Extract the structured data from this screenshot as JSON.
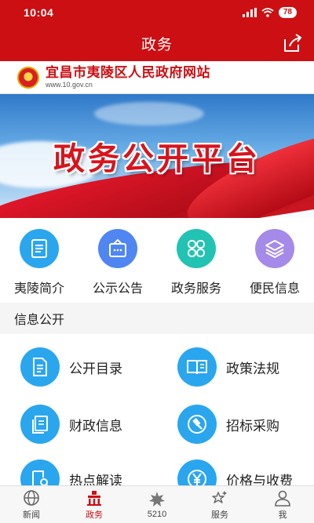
{
  "status_bar": {
    "time": "10:04",
    "battery": "78"
  },
  "nav": {
    "title": "政务"
  },
  "site": {
    "name": "宜昌市夷陵区人民政府网站",
    "url": "www.10.gov.cn"
  },
  "banner": {
    "title": "政务公开平台"
  },
  "quick_links": [
    {
      "label": "夷陵简介",
      "icon": "document-icon",
      "color": "#2aa6ee"
    },
    {
      "label": "公示公告",
      "icon": "notice-board-icon",
      "color": "#4f86f2"
    },
    {
      "label": "政务服务",
      "icon": "clover-grid-icon",
      "color": "#22c3b3"
    },
    {
      "label": "便民信息",
      "icon": "layers-icon",
      "color": "#a58ae9"
    }
  ],
  "section": {
    "title": "信息公开"
  },
  "info_items": [
    {
      "label": "公开目录",
      "icon": "doc-list-icon"
    },
    {
      "label": "政策法规",
      "icon": "open-book-icon"
    },
    {
      "label": "财政信息",
      "icon": "stacked-docs-icon"
    },
    {
      "label": "招标采购",
      "icon": "gavel-icon"
    },
    {
      "label": "热点解读",
      "icon": "doc-search-icon"
    },
    {
      "label": "价格与收费",
      "icon": "yen-icon"
    }
  ],
  "tabs": [
    {
      "label": "新闻",
      "icon": "globe-icon",
      "active": false
    },
    {
      "label": "政务",
      "icon": "government-building-icon",
      "active": true
    },
    {
      "label": "5210",
      "icon": "leaf-icon",
      "active": false
    },
    {
      "label": "服务",
      "icon": "star-sparkle-icon",
      "active": false
    },
    {
      "label": "我",
      "icon": "user-icon",
      "active": false
    }
  ],
  "colors": {
    "brand_red": "#cc0f13",
    "info_blue": "#2aa6ee"
  }
}
